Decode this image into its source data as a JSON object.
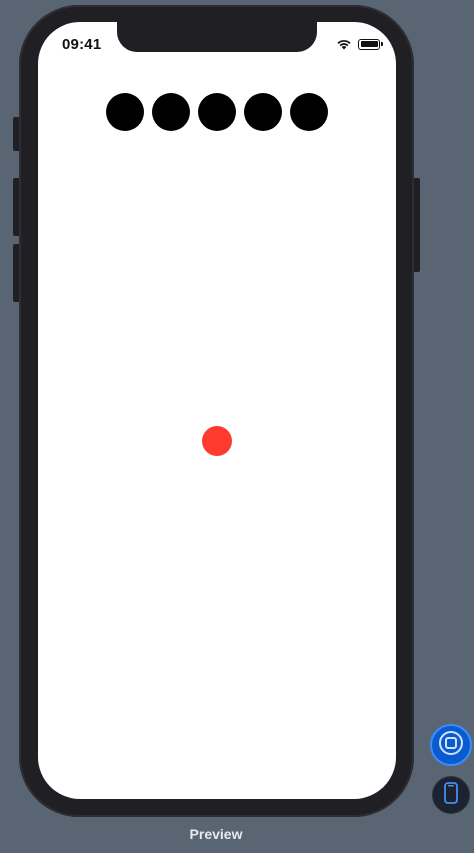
{
  "status_bar": {
    "time": "09:41"
  },
  "dots": [
    {
      "color": "#000000"
    },
    {
      "color": "#000000"
    },
    {
      "color": "#000000"
    },
    {
      "color": "#000000"
    },
    {
      "color": "#000000"
    }
  ],
  "red_dot": {
    "color": "#ff3b30"
  },
  "footer": {
    "label": "Preview"
  },
  "controls": {
    "live_preview_icon": "live-preview-icon",
    "device_icon": "device-icon"
  },
  "colors": {
    "background": "#5a6574",
    "accent": "#0a5ad0"
  }
}
